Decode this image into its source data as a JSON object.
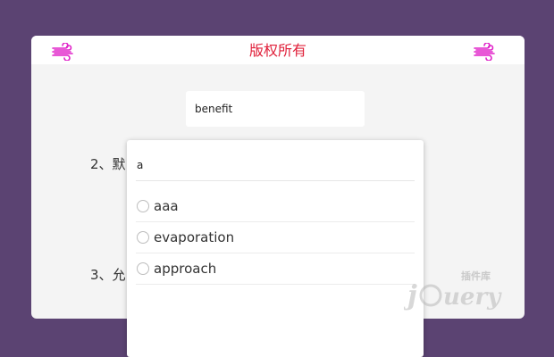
{
  "header": {
    "title": "版权所有",
    "left_icon": "wind-icon",
    "right_icon": "wind-icon",
    "accent_color": "#e0203a",
    "icon_color": "#e020c8"
  },
  "search": {
    "value": "benefit"
  },
  "rows": [
    {
      "label": "2、默"
    },
    {
      "label": "3、允"
    }
  ],
  "dropdown": {
    "filter_value": "a",
    "options": [
      {
        "label": "aaa",
        "selected": false
      },
      {
        "label": "evaporation",
        "selected": false
      },
      {
        "label": "approach",
        "selected": false
      }
    ]
  },
  "watermark": {
    "brand": "jQuery",
    "tag": "插件库"
  }
}
